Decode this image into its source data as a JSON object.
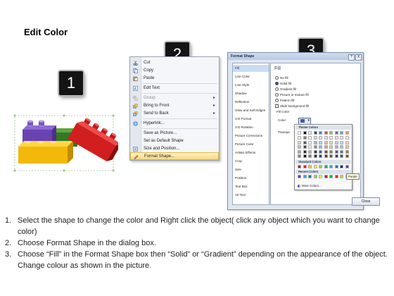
{
  "title": "Edit Color",
  "steps": [
    {
      "label": "1"
    },
    {
      "label": "2"
    },
    {
      "label": "3"
    }
  ],
  "context_menu": {
    "items": [
      {
        "label": "Cut",
        "icon": "scissors-icon",
        "enabled": true
      },
      {
        "label": "Copy",
        "icon": "copy-icon",
        "enabled": true
      },
      {
        "label": "Paste",
        "icon": "paste-icon",
        "enabled": true
      },
      {
        "label": "Edit Text",
        "icon": "edit-text-icon",
        "enabled": true
      },
      {
        "label": "Group",
        "icon": "group-icon",
        "enabled": false,
        "submenu": true
      },
      {
        "label": "Bring to Front",
        "icon": "bring-front-icon",
        "enabled": true,
        "submenu": true
      },
      {
        "label": "Send to Back",
        "icon": "send-back-icon",
        "enabled": true,
        "submenu": true
      },
      {
        "label": "Hyperlink...",
        "icon": "hyperlink-icon",
        "enabled": true
      },
      {
        "label": "Save as Picture...",
        "icon": "",
        "enabled": true
      },
      {
        "label": "Set as Default Shape",
        "icon": "",
        "enabled": true
      },
      {
        "label": "Size and Position...",
        "icon": "size-position-icon",
        "enabled": true
      },
      {
        "label": "Format Shape...",
        "icon": "format-shape-icon",
        "enabled": true,
        "highlighted": true
      }
    ]
  },
  "dialog": {
    "title": "Format Shape",
    "title_buttons": [
      "?",
      "X"
    ],
    "nav": [
      {
        "label": "Fill",
        "selected": true
      },
      {
        "label": "Line Color"
      },
      {
        "label": "Line Style"
      },
      {
        "label": "Shadow"
      },
      {
        "label": "Reflection"
      },
      {
        "label": "Glow and Soft Edges"
      },
      {
        "label": "3-D Format"
      },
      {
        "label": "3-D Rotation"
      },
      {
        "label": "Picture Corrections"
      },
      {
        "label": "Picture Color"
      },
      {
        "label": "Artistic Effects"
      },
      {
        "label": "Crop"
      },
      {
        "label": "Size"
      },
      {
        "label": "Position"
      },
      {
        "label": "Text Box"
      },
      {
        "label": "Alt Text"
      }
    ],
    "panel_heading": "Fill",
    "fill_options": [
      {
        "label": "No fill",
        "selected": false
      },
      {
        "label": "Solid fill",
        "selected": true
      },
      {
        "label": "Gradient fill",
        "selected": false
      },
      {
        "label": "Picture or texture fill",
        "selected": false
      },
      {
        "label": "Pattern fill",
        "selected": false
      }
    ],
    "slide_background": "Slide background fill",
    "fill_color_label": "Fill Color",
    "color_label": "Color:",
    "transparency_label": "Transpa",
    "close_label": "Close"
  },
  "palette": {
    "theme_colors_label": "Theme Colors",
    "standard_colors_label": "Standard Colors",
    "recent_colors_label": "Recent Colors",
    "more_colors_label": "More Colors...",
    "tooltip": "Purple",
    "theme_top": [
      "#ffffff",
      "#000000",
      "#eeece1",
      "#1f497d",
      "#4f81bd",
      "#c0504d",
      "#9bbb59",
      "#8064a2",
      "#4bacc6",
      "#f79646"
    ],
    "standard": [
      "#c00000",
      "#ff0000",
      "#ffc000",
      "#ffff00",
      "#92d050",
      "#00b050",
      "#00b0f0",
      "#0070c0",
      "#002060",
      "#7030a0"
    ],
    "recent": [
      "#7030a0",
      "#00b0f0",
      "#0070c0",
      "#92d050",
      "#ffff00",
      "#c00000",
      "#00b050",
      "#ff0000",
      "#ffc000",
      "#002060"
    ]
  },
  "instructions": [
    {
      "num": "1.",
      "text": "Select the shape to change the color and Right click the object( click any object which you want to change color)"
    },
    {
      "num": "2.",
      "text": "Choose Format Shape in the dialog box."
    },
    {
      "num": "3.",
      "text": "Choose “Fill” in the Format Shape box then “Solid” or “Gradient” depending on the appearance of the object. Change colour as shown in the picture."
    }
  ]
}
